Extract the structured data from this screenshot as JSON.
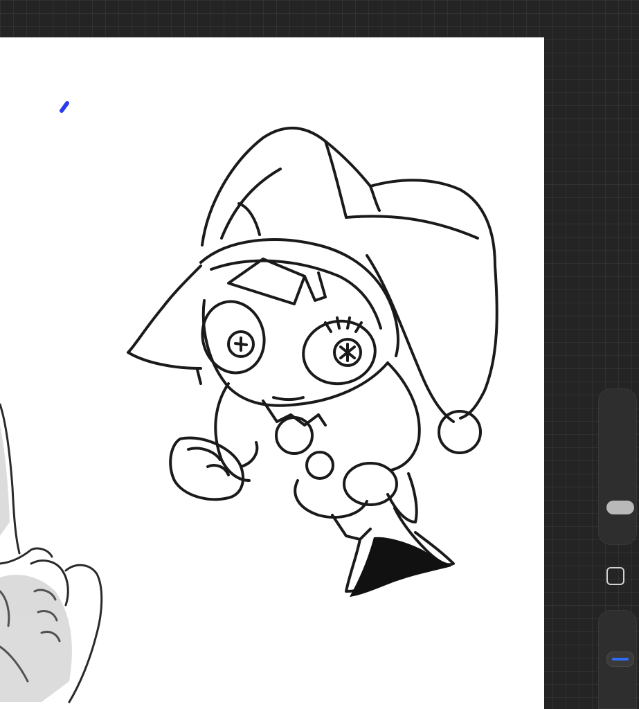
{
  "app": {
    "name": "",
    "canvas_background": "#ffffff",
    "workspace_background": "#242424"
  },
  "brush": {
    "color": "#2b3cf0",
    "icon": "blue-stroke"
  },
  "sidebar": {
    "brush_size_icon": "slider-thumb",
    "modify_icon": "square-outline",
    "opacity_icon": "slider-thumb-blue",
    "accent_color": "#2f6df6"
  }
}
